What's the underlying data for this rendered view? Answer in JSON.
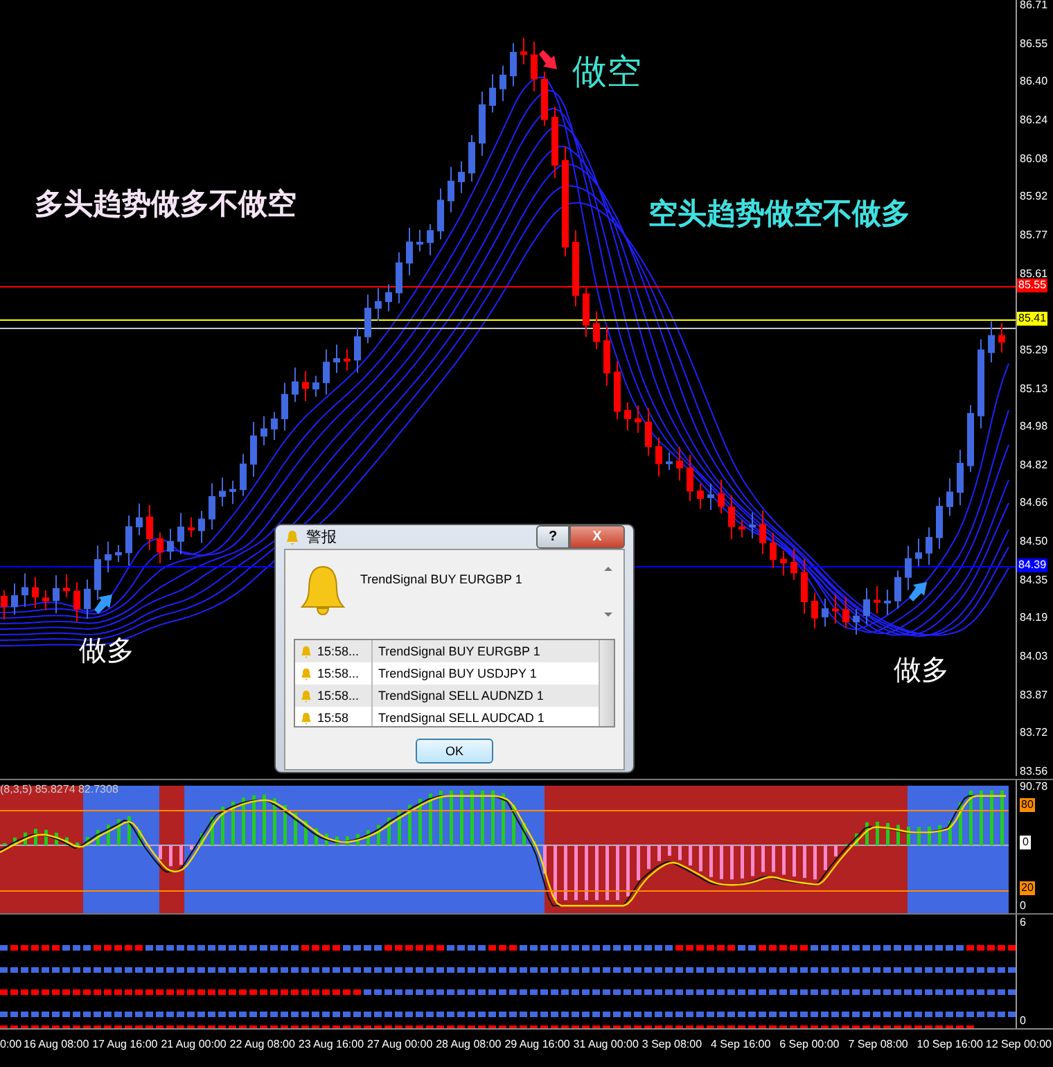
{
  "price_axis": {
    "labels": [
      "86.71",
      "86.55",
      "86.40",
      "86.24",
      "86.08",
      "85.92",
      "85.77",
      "85.61",
      "85.29",
      "85.13",
      "84.98",
      "84.82",
      "84.66",
      "84.50",
      "84.35",
      "84.19",
      "84.03",
      "83.87",
      "83.72",
      "83.56"
    ],
    "markers": [
      {
        "text": "85.55",
        "color": "#ff0000"
      },
      {
        "text": "85.41",
        "color": "#ffff00"
      },
      {
        "text": "84.39",
        "color": "#0000ff"
      }
    ]
  },
  "annotations": [
    {
      "text": "做空",
      "color": "#40e0d0"
    },
    {
      "text": "多头趋势做多不做空",
      "color": "#f4e4f4"
    },
    {
      "text": "空头趋势做空不做多",
      "color": "#40e0e0"
    },
    {
      "text": "做多",
      "color": "#ffffff"
    },
    {
      "text": "做多",
      "color": "#ffffff"
    }
  ],
  "signal_arrows": [
    {
      "kind": "sell"
    },
    {
      "kind": "buy"
    },
    {
      "kind": "buy"
    }
  ],
  "indicator": {
    "label": "(8,3,5) 85.8274 82.7308",
    "scale": [
      {
        "text": "90.78",
        "kind": "plain"
      },
      {
        "text": "80",
        "kind": "level"
      },
      {
        "text": "0",
        "kind": "zero"
      },
      {
        "text": "20",
        "kind": "level"
      },
      {
        "text": "0",
        "kind": "plain"
      }
    ]
  },
  "signal_panel": {
    "scale": [
      "6",
      "0"
    ]
  },
  "time_axis": [
    "0:00",
    "16 Aug 08:00",
    "17 Aug 16:00",
    "21 Aug 00:00",
    "22 Aug 08:00",
    "23 Aug 16:00",
    "27 Aug 00:00",
    "28 Aug 08:00",
    "29 Aug 16:00",
    "31 Aug 00:00",
    "3 Sep 08:00",
    "4 Sep 16:00",
    "6 Sep 00:00",
    "7 Sep 08:00",
    "10 Sep 16:00",
    "12 Sep 00:00"
  ],
  "dialog": {
    "title": "警报",
    "help": "?",
    "close": "X",
    "message": "TrendSignal BUY  EURGBP  1",
    "ok": "OK",
    "rows": [
      {
        "time": "15:58...",
        "text": "TrendSignal BUY  EURGBP  1"
      },
      {
        "time": "15:58...",
        "text": "TrendSignal BUY  USDJPY  1"
      },
      {
        "time": "15:58...",
        "text": "TrendSignal SELL  AUDNZD  1"
      },
      {
        "time": "15:58",
        "text": "TrendSignal SELL  AUDCAD  1"
      }
    ]
  }
}
